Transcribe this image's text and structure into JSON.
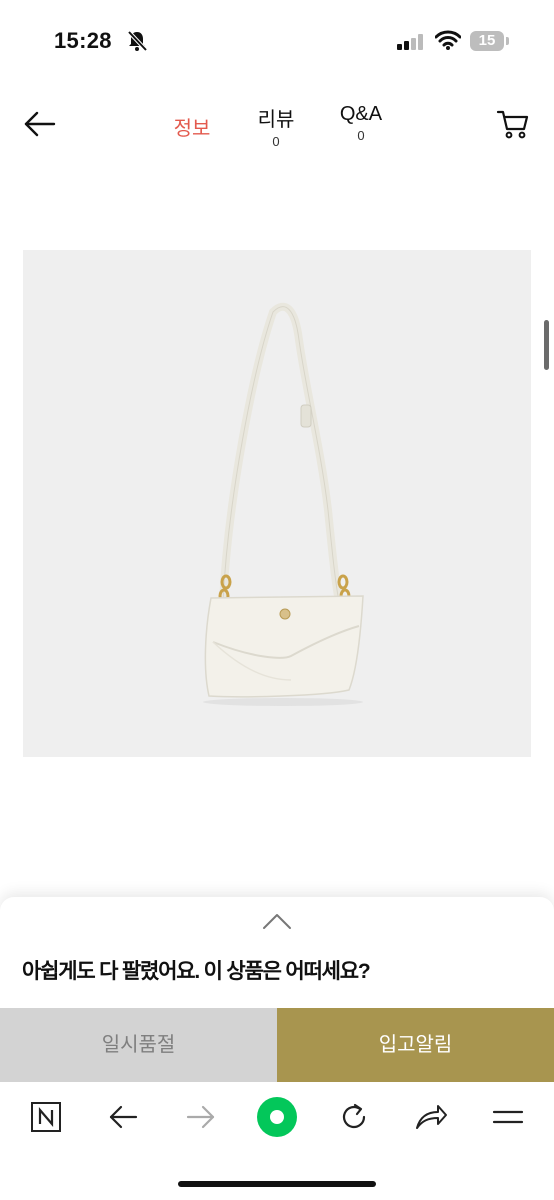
{
  "status_bar": {
    "time": "15:28",
    "battery": "15",
    "icons": [
      "bell-slash-icon",
      "signal-icon",
      "wifi-icon",
      "battery-icon"
    ]
  },
  "header": {
    "back_icon": "arrow-left-icon",
    "tabs": [
      {
        "label": "정보",
        "count": ""
      },
      {
        "label": "리뷰",
        "count": "0"
      },
      {
        "label": "Q&A",
        "count": "0"
      }
    ],
    "cart_icon": "cart-icon",
    "active_color": "#e35a4e"
  },
  "product": {
    "image_icon": "white-shoulder-bag-image",
    "background": "#efefef"
  },
  "sheet": {
    "expand_icon": "chevron-up-icon",
    "message": "아쉽게도 다 팔렸어요. 이 상품은 어떠세요?",
    "sold_out_label": "일시품절",
    "notify_label": "입고알림",
    "notify_color": "#a8954f",
    "sold_out_color": "#d3d3d3"
  },
  "browser_toolbar": {
    "icons": [
      "naver-n-icon",
      "back-arrow-icon",
      "forward-arrow-icon",
      "green-circle-icon",
      "reload-icon",
      "share-icon",
      "menu-icon"
    ],
    "accent": "#03c75a"
  }
}
